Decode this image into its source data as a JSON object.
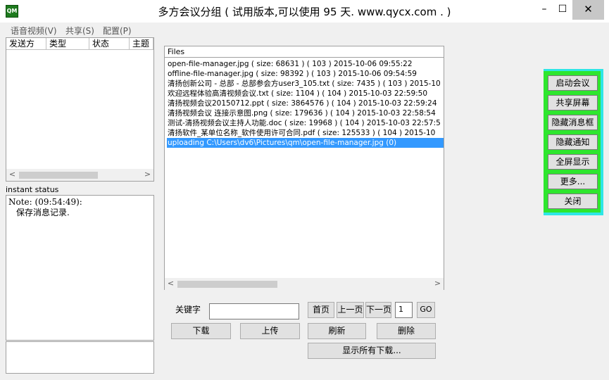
{
  "window": {
    "title": "多方会议分组 ( 试用版本,可以使用 95 天. www.qycx.com . )",
    "icon_text": "QM",
    "icons": {
      "minimize": "minimize-icon",
      "maximize": "maximize-icon",
      "close": "close-icon"
    }
  },
  "menu": {
    "items": [
      "语音视频(V)",
      "共享(S)",
      "配置(P)"
    ]
  },
  "message_list": {
    "columns": [
      "发送方",
      "类型",
      "状态",
      "主题"
    ]
  },
  "status": {
    "label": "instant status",
    "note": "Note: (09:54:49):",
    "message": "保存消息记录."
  },
  "files": {
    "header": "Files",
    "rows": [
      "open-file-manager.jpg  ( size: 68631 ) ( 103 ) 2015-10-06 09:55:22",
      "offline-file-manager.jpg  ( size: 98392 ) ( 103 ) 2015-10-06 09:54:59",
      "清扬创新公司 - 总部 - 总部参会方user3_105.txt  ( size: 7435 ) ( 103 ) 2015-10",
      "欢迎远程体验高清视频会议.txt  ( size: 1104 ) ( 104 ) 2015-10-03 22:59:50",
      "清扬视频会议20150712.ppt  ( size: 3864576 ) ( 104 ) 2015-10-03 22:59:24",
      "清扬视频会议 连接示意图.png  ( size: 179636 ) ( 104 ) 2015-10-03 22:58:54",
      "测试-清扬视频会议主持人功能.doc  ( size: 19968 ) ( 104 ) 2015-10-03 22:57:5",
      "清扬软件_某单位名称_软件使用许可合同.pdf  ( size: 125533 ) ( 104 ) 2015-10",
      "uploading C:\\Users\\dv6\\Pictures\\qm\\open-file-manager.jpg (0)"
    ],
    "selected_index": 8
  },
  "controls": {
    "keyword_label": "关键字",
    "keyword_value": "",
    "first_page": "首页",
    "prev_page": "上一页",
    "next_page": "下一页",
    "page_number": "1",
    "go": "GO",
    "download": "下载",
    "upload": "上传",
    "refresh": "刷新",
    "delete": "删除",
    "show_all_downloads": "显示所有下载..."
  },
  "side_panel": {
    "buttons": [
      "启动会议",
      "共享屏幕",
      "隐藏消息框",
      "隐藏通知",
      "全屏显示",
      "更多...",
      "关闭"
    ]
  },
  "colors": {
    "selection": "#3399ff",
    "side_panel_green": "#2ee62e",
    "side_panel_cyan": "#2ee6e6",
    "close_button": "#c7c7c7"
  }
}
